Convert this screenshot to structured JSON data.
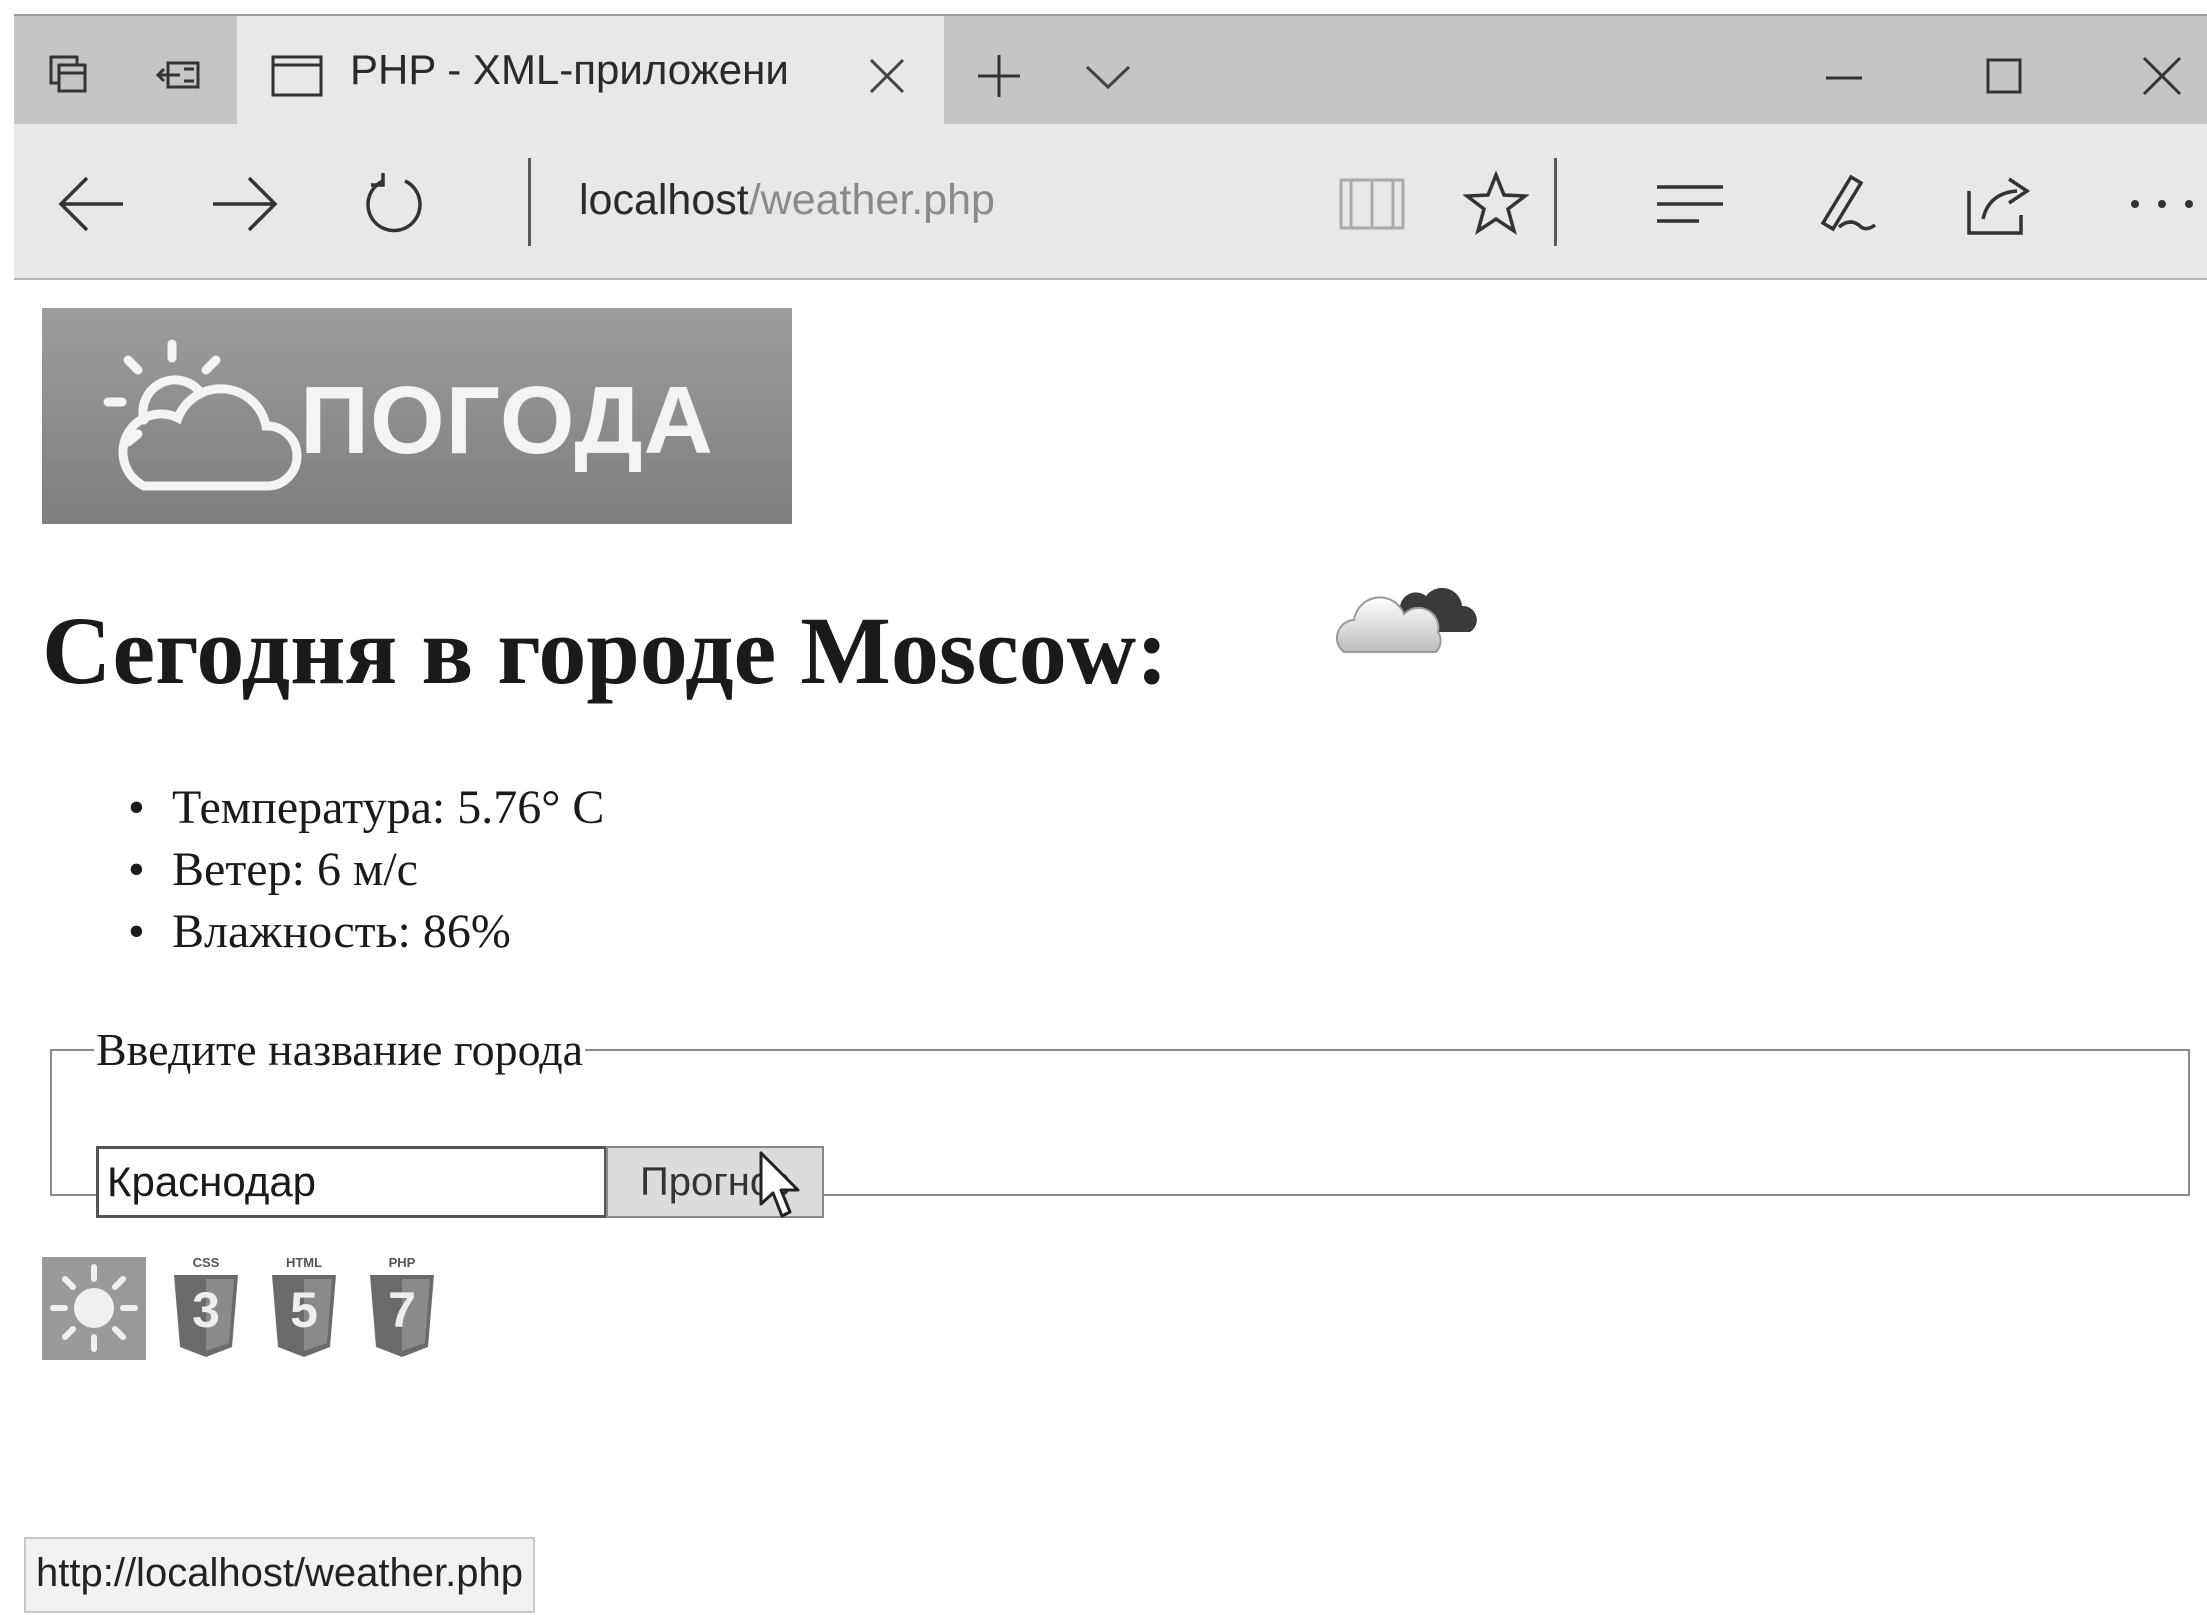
{
  "browser": {
    "tab_title": "PHP - XML-приложени",
    "address_host": "localhost",
    "address_path": "/weather.php",
    "status_url": "http://localhost/weather.php"
  },
  "page": {
    "banner_text": "ПОГОДА",
    "heading": "Сегодня в городе Moscow:",
    "stats": [
      {
        "text": "Температура: 5.76° C"
      },
      {
        "text": "Ветер: 6 м/с"
      },
      {
        "text": "Влажность: 86%"
      }
    ],
    "form": {
      "legend": "Введите название города",
      "city_value": "Краснодар",
      "submit_label": "Прогноз"
    }
  },
  "badges": [
    {
      "name": "sun-badge-icon"
    },
    {
      "name": "css3-badge-icon",
      "label": "CSS",
      "glyph": "3"
    },
    {
      "name": "html5-badge-icon",
      "label": "HTML",
      "glyph": "5"
    },
    {
      "name": "php7-badge-icon",
      "label": "PHP",
      "glyph": "7"
    }
  ]
}
